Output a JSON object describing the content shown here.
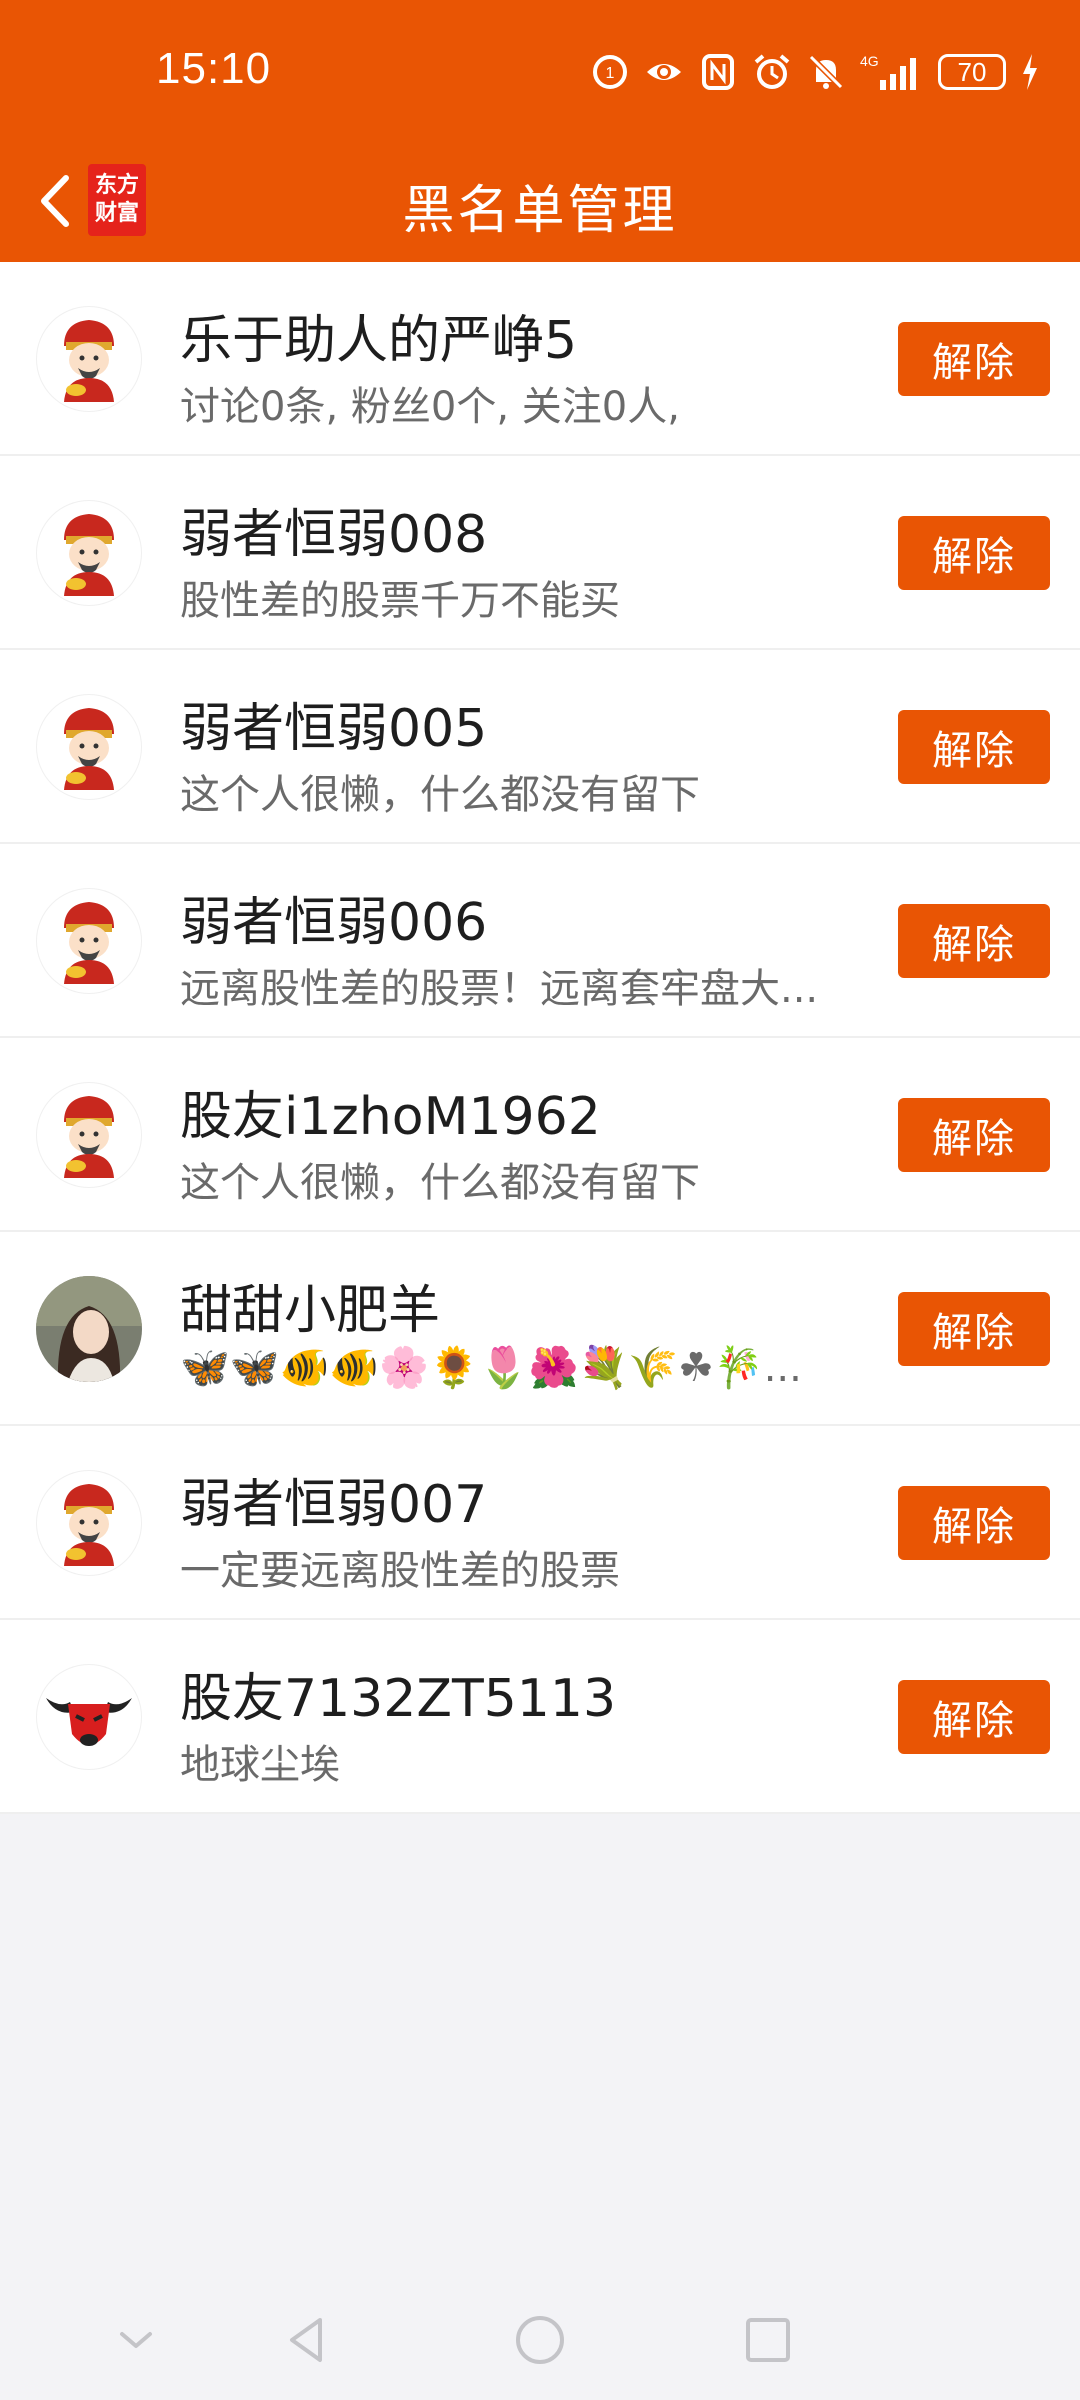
{
  "status_bar": {
    "time": "15:10",
    "network_label": "4G",
    "battery_level": "70",
    "icons": [
      "hd-call-icon",
      "eye-icon",
      "nfc-icon",
      "alarm-icon",
      "mute-icon",
      "signal-icon",
      "battery-icon",
      "charging-icon"
    ]
  },
  "header": {
    "title": "黑名单管理",
    "logo_line1": "东方",
    "logo_line2": "财富",
    "back_icon": "back-arrow-icon",
    "accent_color": "#e95504"
  },
  "blocked_users": [
    {
      "name": "乐于助人的严峥5",
      "desc": "讨论0条, 粉丝0个, 关注0人,",
      "avatar": "caishen-avatar"
    },
    {
      "name": "弱者恒弱008",
      "desc": "股性差的股票千万不能买",
      "avatar": "caishen-avatar"
    },
    {
      "name": "弱者恒弱005",
      "desc": "这个人很懒，什么都没有留下",
      "avatar": "caishen-avatar"
    },
    {
      "name": "弱者恒弱006",
      "desc": "远离股性差的股票！远离套牢盘大...",
      "avatar": "caishen-avatar"
    },
    {
      "name": "股友i1zhoM1962",
      "desc": "这个人很懒，什么都没有留下",
      "avatar": "caishen-avatar"
    },
    {
      "name": "甜甜小肥羊",
      "desc": "🦋🦋🐠🐠🌸🌻🌷🌺💐🌾☘🎋...",
      "avatar": "photo-avatar"
    },
    {
      "name": "弱者恒弱007",
      "desc": "一定要远离股性差的股票",
      "avatar": "caishen-avatar"
    },
    {
      "name": "股友7132ZT5113",
      "desc": "地球尘埃",
      "avatar": "red-bull-avatar"
    }
  ],
  "remove_label": "解除",
  "nav_bar": [
    "collapse-icon",
    "back-icon",
    "home-icon",
    "recents-icon"
  ]
}
